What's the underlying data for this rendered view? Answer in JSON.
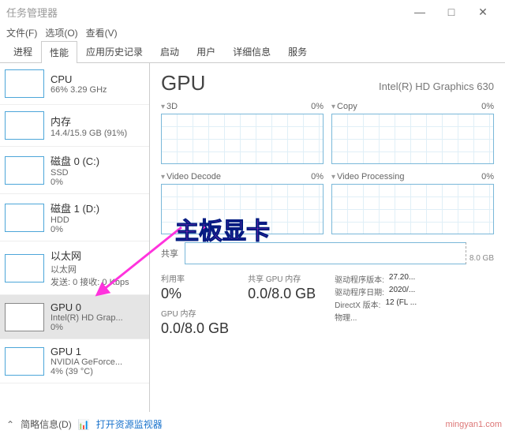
{
  "window": {
    "title": "任务管理器"
  },
  "menu": {
    "file": "文件(F)",
    "options": "选项(O)",
    "view": "查看(V)"
  },
  "winbtns": {
    "min": "—",
    "max": "□",
    "close": "✕"
  },
  "tabs": [
    "进程",
    "性能",
    "应用历史记录",
    "启动",
    "用户",
    "详细信息",
    "服务"
  ],
  "activeTab": 1,
  "side": {
    "items": [
      {
        "name": "CPU",
        "sub": "66% 3.29 GHz"
      },
      {
        "name": "内存",
        "sub": "14.4/15.9 GB (91%)"
      },
      {
        "name": "磁盘 0 (C:)",
        "sub": "SSD",
        "sub2": "0%"
      },
      {
        "name": "磁盘 1 (D:)",
        "sub": "HDD",
        "sub2": "0%"
      },
      {
        "name": "以太网",
        "sub": "以太网",
        "sub2": "发送: 0 接收: 0 Kbps"
      },
      {
        "name": "GPU 0",
        "sub": "Intel(R) HD Grap...",
        "sub2": "0%"
      },
      {
        "name": "GPU 1",
        "sub": "NVIDIA GeForce...",
        "sub2": "4% (39 °C)"
      }
    ],
    "selected": 5
  },
  "main": {
    "title": "GPU",
    "model": "Intel(R) HD Graphics 630",
    "charts": [
      {
        "name": "3D",
        "pct": "0%"
      },
      {
        "name": "Copy",
        "pct": "0%"
      },
      {
        "name": "Video Decode",
        "pct": "0%"
      },
      {
        "name": "Video Processing",
        "pct": "0%"
      }
    ],
    "shared": {
      "label": "共享",
      "max": "8.0 GB"
    },
    "stats": {
      "util_label": "利用率",
      "util": "0%",
      "shared_label": "共享 GPU 内存",
      "shared": "0.0/8.0 GB",
      "gpumem_label": "GPU 内存",
      "gpumem": "0.0/8.0 GB",
      "driver_ver_l": "驱动程序版本:",
      "driver_ver": "27.20...",
      "driver_date_l": "驱动程序日期:",
      "driver_date": "2020/...",
      "dx_l": "DirectX 版本:",
      "dx": "12 (FL ...",
      "phys_l": "物理...",
      "phys": ""
    }
  },
  "footer": {
    "arrow": "⌃",
    "brief": "简略信息(D)",
    "link": "打开资源监视器"
  },
  "overlay": {
    "text": "主板显卡"
  },
  "watermark": "mingyan1.com"
}
